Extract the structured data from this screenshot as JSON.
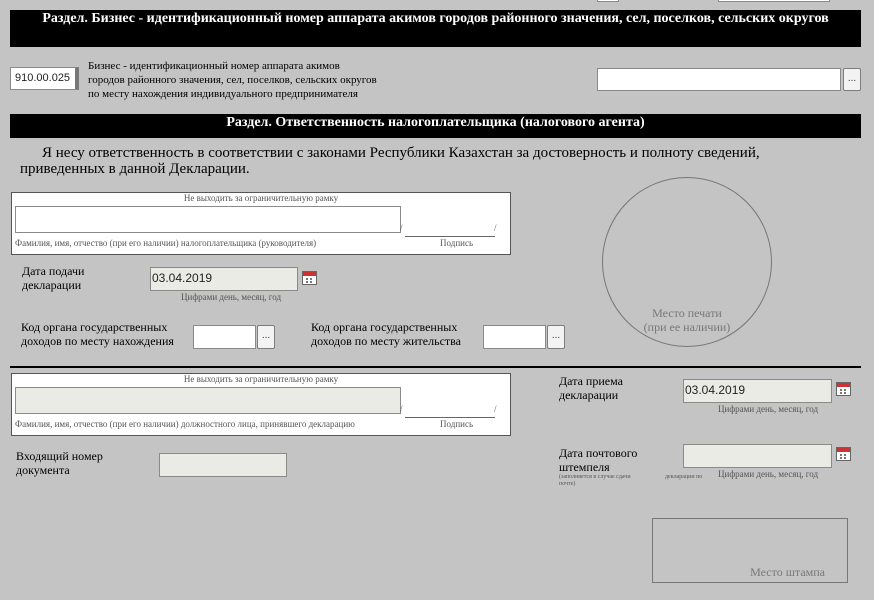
{
  "section_biz": {
    "title": "Раздел. Бизнес - идентификационный номер аппарата акимов городов районного значения, сел, поселков, сельских округов"
  },
  "field_910": {
    "code": "910.00.025",
    "label_l1": "Бизнес - идентификационный номер аппарата акимов",
    "label_l2": "городов районного значения, сел, поселков, сельских округов",
    "label_l3": "по месту нахождения индивидуального предпринимателя",
    "value": "",
    "picker": "..."
  },
  "section_resp": {
    "title": "Раздел. Ответственность налогоплательщика (налогового агента)"
  },
  "declaration_text": {
    "l1": "Я несу ответственность в соответствии с законами Республики Казахстан за достоверность и полноту сведений,",
    "l2": "приведенных в данной Декларации."
  },
  "taxpayer_box": {
    "note": "Не выходить за ограничительную рамку",
    "name_caption": "Фамилия, имя, отчество (при его наличии) налогоплательщика (руководителя)",
    "signature_caption": "Подпись",
    "slash": "/"
  },
  "submit_date": {
    "label_l1": "Дата подачи",
    "label_l2": "декларации",
    "value": "03.04.2019",
    "hint": "Цифрами день, месяц, год"
  },
  "stamp_circle": {
    "l1": "Место печати",
    "l2": "(при ее наличии)"
  },
  "org_location": {
    "label_l1": "Код органа государственных",
    "label_l2": "доходов по месту нахождения",
    "value": "",
    "picker": "..."
  },
  "org_residence": {
    "label_l1": "Код органа государственных",
    "label_l2": "доходов по месту жительства",
    "value": "",
    "picker": "..."
  },
  "official_box": {
    "note": "Не выходить за ограничительную рамку",
    "name_caption": "Фамилия, имя, отчество (при его наличии) должностного лица, принявшего декларацию",
    "signature_caption": "Подпись",
    "slash": "/"
  },
  "receive_date": {
    "label_l1": "Дата приема",
    "label_l2": "декларации",
    "value": "03.04.2019",
    "hint": "Цифрами день, месяц, год"
  },
  "incoming_number": {
    "label_l1": "Входящий номер",
    "label_l2": "документа",
    "value": ""
  },
  "postmark_date": {
    "label_l1": "Дата почтового",
    "label_l2": "штемпеля",
    "value": "",
    "hint": "Цифрами день, месяц, год",
    "note_a": "(заполняется в случае сдачи",
    "note_b": "почте)",
    "note_c": "декларации по"
  },
  "stamp_box": {
    "label": "Место штампа"
  }
}
